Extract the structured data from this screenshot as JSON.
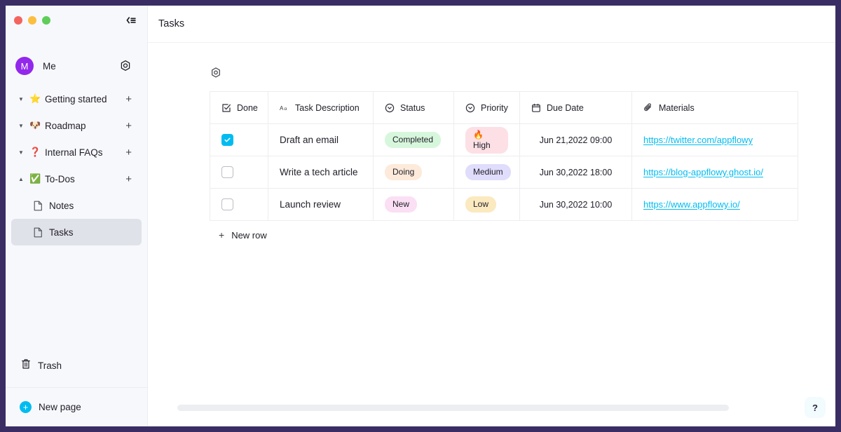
{
  "window": {
    "frame_color": "#3a2d63",
    "traffic_lights": [
      "close-red",
      "minimize-yellow",
      "maximize-green"
    ],
    "collapse_sidebar_label": "«"
  },
  "sidebar": {
    "user": {
      "avatar_initial": "M",
      "name": "Me",
      "settings_icon": "gear-icon"
    },
    "items": [
      {
        "emoji": "⭐",
        "label": "Getting started",
        "expandable": true,
        "expanded": false,
        "add_label": "+"
      },
      {
        "emoji": "🐶",
        "label": "Roadmap",
        "expandable": true,
        "expanded": false,
        "add_label": "+"
      },
      {
        "emoji": "❓",
        "label": "Internal FAQs",
        "expandable": true,
        "expanded": false,
        "add_label": "+"
      },
      {
        "emoji": "✅",
        "label": "To-Dos",
        "expandable": true,
        "expanded": true,
        "add_label": "+"
      }
    ],
    "children": [
      {
        "label": "Notes",
        "icon": "document-icon",
        "selected": false
      },
      {
        "label": "Tasks",
        "icon": "document-icon",
        "selected": true
      }
    ],
    "trash": {
      "label": "Trash",
      "icon": "trash-icon"
    },
    "new_page": {
      "label": "New page",
      "icon": "plus-circle-icon"
    }
  },
  "header": {
    "title": "Tasks"
  },
  "grid": {
    "settings_icon": "grid-settings-icon",
    "add_column_label": "+",
    "new_row_label": "New row",
    "new_row_plus": "+",
    "columns": [
      {
        "label": "Done",
        "icon": "checkbox-field-icon",
        "type": "checkbox"
      },
      {
        "label": "Task Description",
        "icon": "text-field-icon",
        "type": "text"
      },
      {
        "label": "Status",
        "icon": "single-select-icon",
        "type": "select"
      },
      {
        "label": "Priority",
        "icon": "single-select-icon",
        "type": "select"
      },
      {
        "label": "Due Date",
        "icon": "calendar-icon",
        "type": "date"
      },
      {
        "label": "Materials",
        "icon": "attachment-icon",
        "type": "url"
      }
    ],
    "rows": [
      {
        "done": true,
        "task": "Draft an email",
        "status": {
          "label": "Completed",
          "bg": "#d7f7dc"
        },
        "priority": {
          "label": "🔥 High",
          "bg": "#fce0e5"
        },
        "due": "Jun 21,2022  09:00",
        "material": "https://twitter.com/appflowy"
      },
      {
        "done": false,
        "task": "Write a tech article",
        "status": {
          "label": "Doing",
          "bg": "#fdeada"
        },
        "priority": {
          "label": "Medium",
          "bg": "#e0dcfb"
        },
        "due": "Jun 30,2022  18:00",
        "material": "https://blog-appflowy.ghost.io/"
      },
      {
        "done": false,
        "task": "Launch review",
        "status": {
          "label": "New",
          "bg": "#fbdff4"
        },
        "priority": {
          "label": "Low",
          "bg": "#fbe9bf"
        },
        "due": "Jun 30,2022  10:00",
        "material": "https://www.appflowy.io/"
      }
    ]
  },
  "footer": {
    "help_label": "?"
  },
  "colors": {
    "accent": "#00bcf0",
    "avatar": "#9327ec",
    "sidebar_bg": "#f7f8fc",
    "selected_bg": "#e0e2e9",
    "link": "#00bcf0"
  }
}
